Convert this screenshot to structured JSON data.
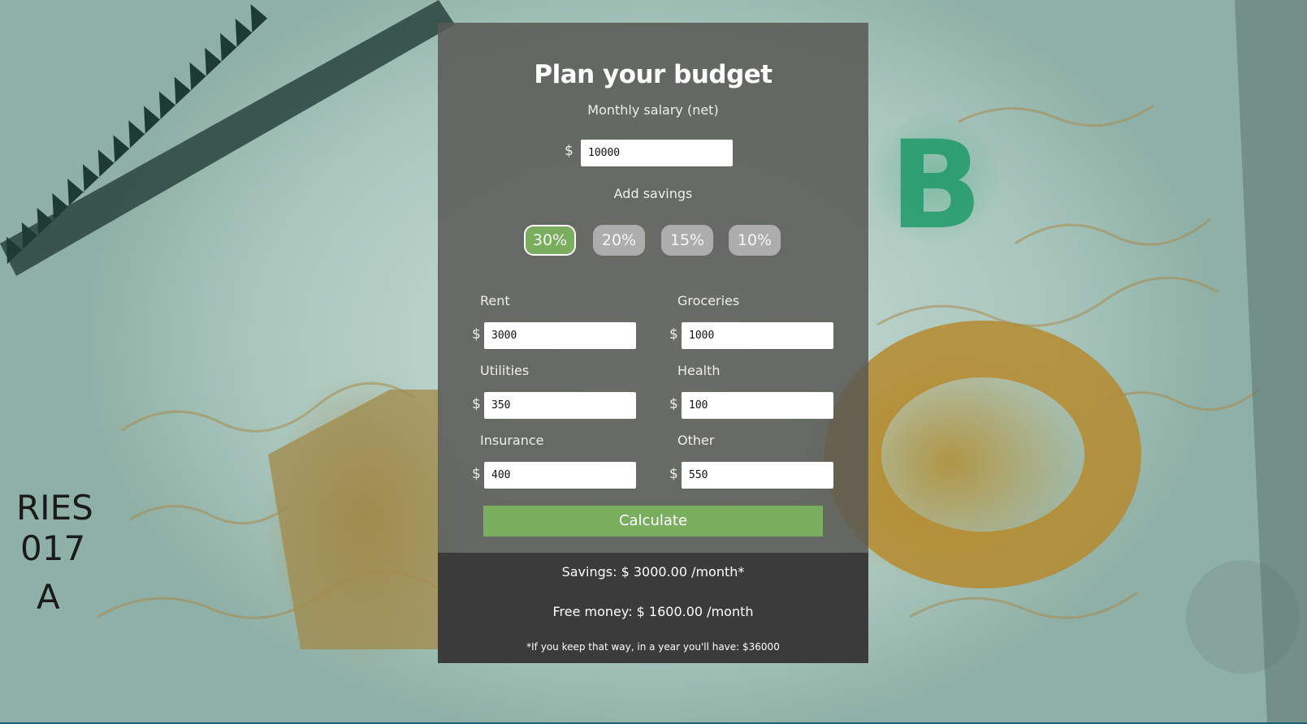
{
  "title": "Plan your budget",
  "salary": {
    "label": "Monthly salary (net)",
    "currency": "$",
    "value": "10000"
  },
  "savings": {
    "label": "Add savings",
    "options": [
      "30%",
      "20%",
      "15%",
      "10%"
    ],
    "selected": "30%"
  },
  "expenses": {
    "currency": "$",
    "rent": {
      "label": "Rent",
      "value": "3000"
    },
    "groceries": {
      "label": "Groceries",
      "value": "1000"
    },
    "utilities": {
      "label": "Utilities",
      "value": "350"
    },
    "health": {
      "label": "Health",
      "value": "100"
    },
    "insurance": {
      "label": "Insurance",
      "value": "400"
    },
    "other": {
      "label": "Other",
      "value": "550"
    }
  },
  "calculate_label": "Calculate",
  "results": {
    "savings_line": "Savings: $ 3000.00 /month*",
    "free_money_line": "Free money: $ 1600.00 /month",
    "note": "*If you keep that way, in a year you'll have: $36000"
  },
  "colors": {
    "accent_green": "#79ae5f",
    "panel_bg": "#585854",
    "results_bg": "#3b3b3b"
  },
  "background": {
    "banknote_text": [
      "RIES",
      "017",
      "A"
    ]
  }
}
